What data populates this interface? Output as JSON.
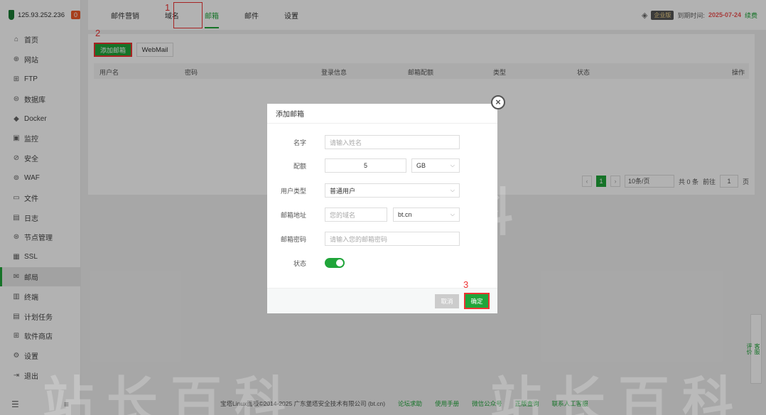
{
  "sidebar": {
    "server_ip": "125.93.252.236",
    "alert_count": "0",
    "items": [
      {
        "icon": "⌂",
        "label": "首页"
      },
      {
        "icon": "⊕",
        "label": "网站"
      },
      {
        "icon": "⊞",
        "label": "FTP"
      },
      {
        "icon": "⊜",
        "label": "数据库"
      },
      {
        "icon": "◆",
        "label": "Docker"
      },
      {
        "icon": "▣",
        "label": "监控"
      },
      {
        "icon": "⊘",
        "label": "安全"
      },
      {
        "icon": "⊚",
        "label": "WAF"
      },
      {
        "icon": "▭",
        "label": "文件"
      },
      {
        "icon": "▤",
        "label": "日志"
      },
      {
        "icon": "⊛",
        "label": "节点管理"
      },
      {
        "icon": "▦",
        "label": "SSL"
      },
      {
        "icon": "✉",
        "label": "邮局"
      },
      {
        "icon": "▥",
        "label": "终端"
      },
      {
        "icon": "▤",
        "label": "计划任务"
      },
      {
        "icon": "⊞",
        "label": "软件商店"
      },
      {
        "icon": "⚙",
        "label": "设置"
      },
      {
        "icon": "⇥",
        "label": "退出"
      }
    ],
    "active_index": 12
  },
  "topbar": {
    "tabs": [
      "邮件营销",
      "域名",
      "邮箱",
      "邮件",
      "设置"
    ],
    "active_tab": 2,
    "edition": "企业版",
    "expire_label": "到期时间:",
    "expire_date": "2025-07-24",
    "renew": "续费"
  },
  "toolbar": {
    "add_mailbox": "添加邮箱",
    "webmail": "WebMail"
  },
  "table": {
    "columns": [
      "用户名",
      "密码",
      "登录信息",
      "邮箱配额",
      "类型",
      "状态",
      "操作"
    ]
  },
  "pager": {
    "current": "1",
    "page_size": "10条/页",
    "total": "共 0 条",
    "goto": "前往",
    "goto_value": "1",
    "page_unit": "页"
  },
  "modal": {
    "title": "添加邮箱",
    "name_label": "名字",
    "name_placeholder": "请输入姓名",
    "quota_label": "配额",
    "quota_value": "5",
    "quota_unit": "GB",
    "user_type_label": "用户类型",
    "user_type_value": "普通用户",
    "address_label": "邮箱地址",
    "address_placeholder": "您的域名",
    "domain_value": "bt.cn",
    "password_label": "邮箱密码",
    "password_placeholder": "请输入您的邮箱密码",
    "status_label": "状态",
    "status_on": true,
    "cancel": "取消",
    "confirm": "确定"
  },
  "footer": {
    "copyright": "宝塔Linux面板©2014-2025 广东堡塔安全技术有限公司 (bt.cn)",
    "links": [
      "论坛求助",
      "使用手册",
      "微信公众号",
      "正版查询",
      "联系人工客服"
    ]
  },
  "float": {
    "service": "客服",
    "review": "评价"
  },
  "steps": [
    "1",
    "2",
    "3"
  ],
  "watermark": "站长百科",
  "colors": {
    "accent": "#20a53a",
    "annotation": "#e33333",
    "badge": "#f05a28"
  }
}
